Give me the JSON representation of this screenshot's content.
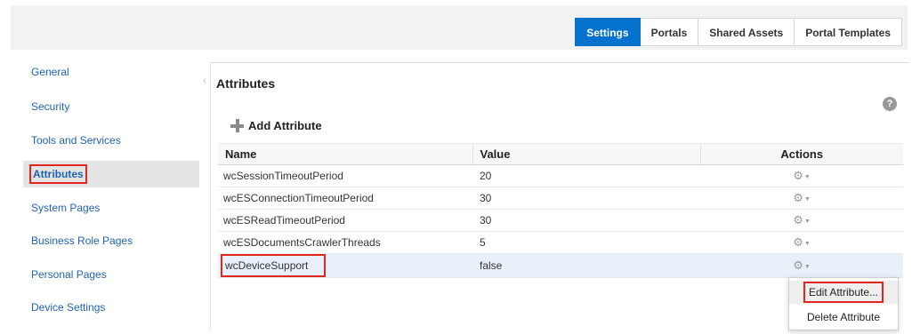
{
  "header": {
    "tabs": [
      {
        "label": "Settings",
        "active": true
      },
      {
        "label": "Portals",
        "active": false
      },
      {
        "label": "Shared Assets",
        "active": false
      },
      {
        "label": "Portal Templates",
        "active": false
      }
    ]
  },
  "sidebar": {
    "items": [
      {
        "label": "General"
      },
      {
        "label": "Security"
      },
      {
        "label": "Tools and Services"
      },
      {
        "label": "Attributes",
        "selected": true
      },
      {
        "label": "System Pages"
      },
      {
        "label": "Business Role Pages"
      },
      {
        "label": "Personal Pages"
      },
      {
        "label": "Device Settings"
      }
    ]
  },
  "main": {
    "title": "Attributes",
    "help_icon": "?",
    "add_label": "Add Attribute",
    "columns": {
      "name": "Name",
      "value": "Value",
      "actions": "Actions"
    },
    "rows": [
      {
        "name": "wcSessionTimeoutPeriod",
        "value": "20"
      },
      {
        "name": "wcESConnectionTimeoutPeriod",
        "value": "30"
      },
      {
        "name": "wcESReadTimeoutPeriod",
        "value": "30"
      },
      {
        "name": "wcESDocumentsCrawlerThreads",
        "value": "5"
      },
      {
        "name": "wcDeviceSupport",
        "value": "false"
      }
    ]
  },
  "context_menu": {
    "items": [
      {
        "label": "Edit Attribute..."
      },
      {
        "label": "Delete Attribute"
      }
    ]
  },
  "icons": {
    "gear": "gear-icon",
    "plus": "plus-icon",
    "help": "help-icon"
  },
  "colors": {
    "accent": "#0572ce",
    "link": "#1f63b0",
    "highlight_box": "#e0261f"
  }
}
